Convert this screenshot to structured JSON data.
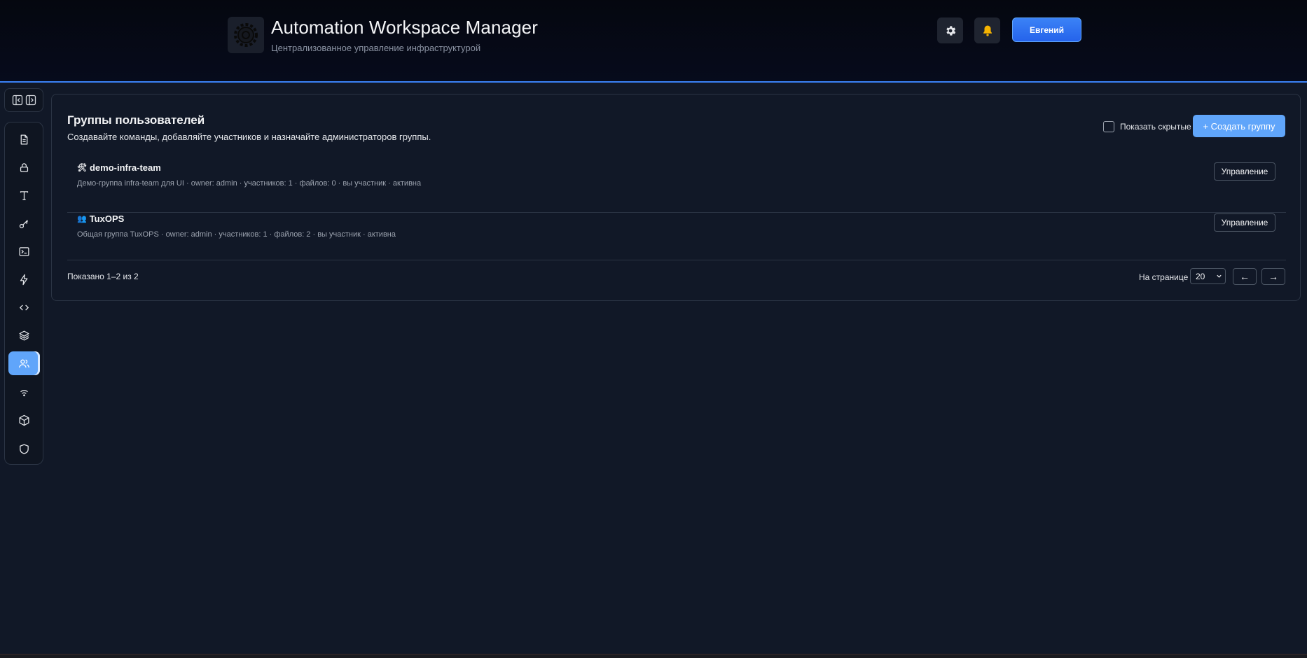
{
  "header": {
    "title": "Automation Workspace Manager",
    "subtitle": "Централизованное управление инфраструктурой",
    "user_button": "Евгений",
    "icons": [
      "gear-icon",
      "bell-icon"
    ]
  },
  "sidebar": {
    "items": [
      {
        "icon": "document-icon"
      },
      {
        "icon": "lock-icon"
      },
      {
        "icon": "text-icon"
      },
      {
        "icon": "key-icon"
      },
      {
        "icon": "terminal-icon"
      },
      {
        "icon": "lightning-icon"
      },
      {
        "icon": "code-icon"
      },
      {
        "icon": "layers-icon"
      },
      {
        "icon": "users-icon",
        "active": true
      },
      {
        "icon": "wifi-icon"
      },
      {
        "icon": "cube-icon"
      },
      {
        "icon": "shield-icon"
      }
    ]
  },
  "main": {
    "title": "Группы пользователей",
    "description": "Создавайте команды, добавляйте участников и назначайте администраторов группы.",
    "show_hidden_label": "Показать скрытые",
    "create_button": "+ Создать группу",
    "groups": [
      {
        "emoji": "🛠",
        "name": "demo-infra-team",
        "meta": "Демо-группа infra-team для UI · owner: admin · участников: 1 · файлов: 0 · вы участник · активна",
        "action": "Управление"
      },
      {
        "emoji": "👥",
        "name": "TuxOPS",
        "meta": "Общая группа TuxOPS · owner: admin · участников: 1 · файлов: 2 · вы участник · активна",
        "action": "Управление"
      }
    ],
    "pagination": {
      "shown": "Показано 1–2 из 2",
      "per_page_label": "На странице",
      "per_page_value": "20",
      "prev": "←",
      "next": "→"
    }
  },
  "colors": {
    "accent": "#3b82f6",
    "accent_light": "#60a5fa",
    "background": "#111827"
  }
}
